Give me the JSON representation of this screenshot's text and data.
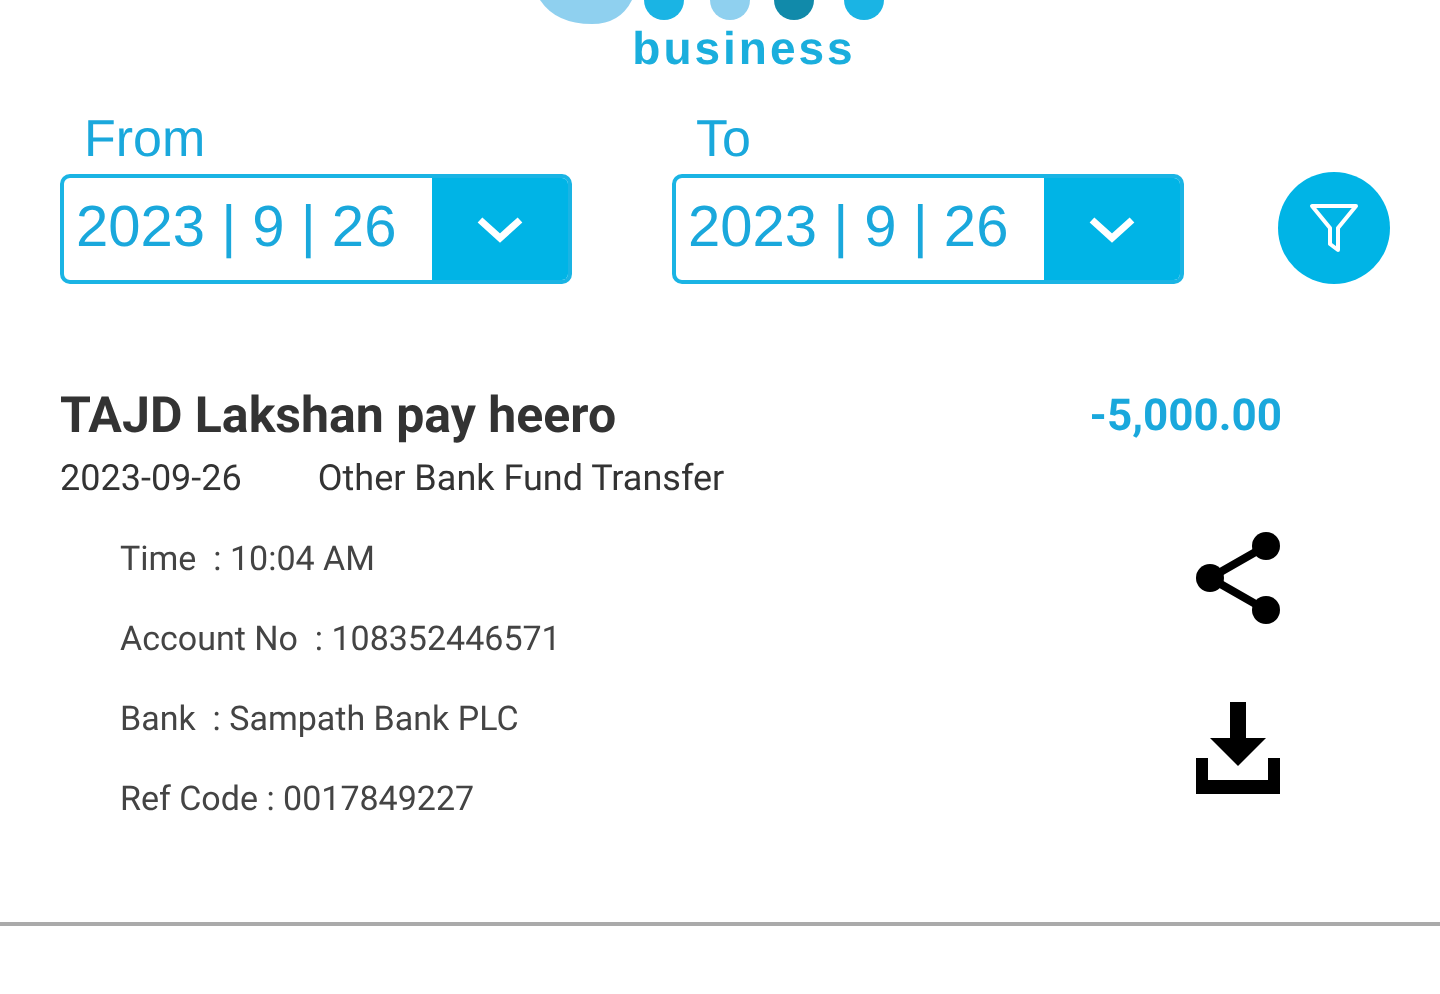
{
  "logo": {
    "text": "business"
  },
  "date_filters": [
    {
      "label": "From",
      "value": "2023 | 9 | 26"
    },
    {
      "label": "To",
      "value": "2023 | 9 | 26"
    }
  ],
  "transaction": {
    "payee": "TAJD Lakshan pay heero",
    "amount": "-5,000.00",
    "date": "2023-09-26",
    "type": "Other Bank Fund Transfer",
    "details": [
      "Time  : 10:04 AM",
      "Account No  : 108352446571",
      "Bank  : Sampath Bank PLC",
      "Ref Code : 0017849227"
    ]
  }
}
